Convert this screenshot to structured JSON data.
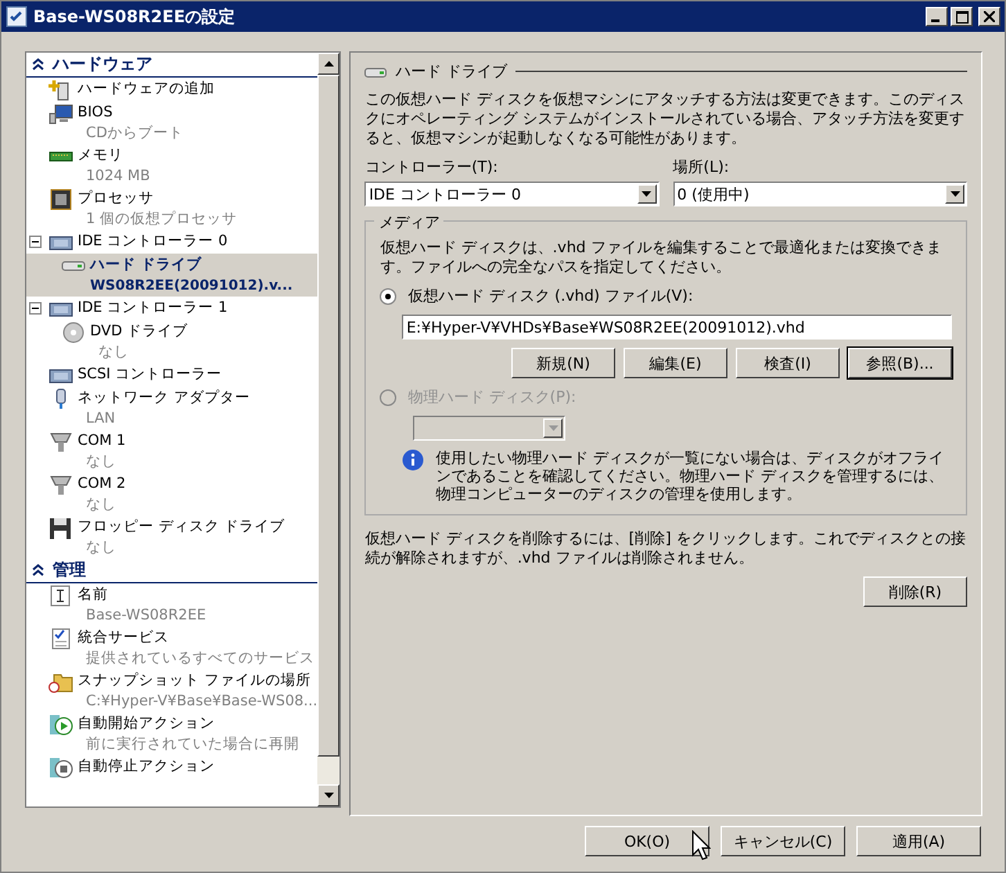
{
  "window": {
    "title": "Base-WS08R2EEの設定"
  },
  "sidebar": {
    "sections": [
      {
        "title": "ハードウェア",
        "items": [
          {
            "name": "ハードウェアの追加",
            "selected": false
          },
          {
            "name": "BIOS",
            "detail": "CDからブート",
            "selected": false
          },
          {
            "name": "メモリ",
            "detail": "1024 MB",
            "selected": false
          },
          {
            "name": "プロセッサ",
            "detail": "1 個の仮想プロセッサ",
            "selected": false
          },
          {
            "name": "IDE コントローラー 0",
            "expanded": true,
            "selected": false,
            "children": [
              {
                "name": "ハード ドライブ",
                "detail": "WS08R2EE(20091012).v...",
                "selected": true
              }
            ]
          },
          {
            "name": "IDE コントローラー 1",
            "expanded": true,
            "selected": false,
            "children": [
              {
                "name": "DVD ドライブ",
                "detail": "なし",
                "selected": false
              }
            ]
          },
          {
            "name": "SCSI コントローラー",
            "selected": false
          },
          {
            "name": "ネットワーク アダプター",
            "detail": "LAN",
            "selected": false
          },
          {
            "name": "COM 1",
            "detail": "なし",
            "selected": false
          },
          {
            "name": "COM 2",
            "detail": "なし",
            "selected": false
          },
          {
            "name": "フロッピー ディスク ドライブ",
            "detail": "なし",
            "selected": false
          }
        ]
      },
      {
        "title": "管理",
        "items": [
          {
            "name": "名前",
            "detail": "Base-WS08R2EE",
            "selected": false
          },
          {
            "name": "統合サービス",
            "detail": "提供されているすべてのサービス",
            "selected": false
          },
          {
            "name": "スナップショット ファイルの場所",
            "detail": "C:¥Hyper-V¥Base¥Base-WS08...",
            "selected": false
          },
          {
            "name": "自動開始アクション",
            "detail": "前に実行されていた場合に再開",
            "selected": false
          },
          {
            "name": "自動停止アクション",
            "selected": false
          }
        ]
      }
    ]
  },
  "panel": {
    "title": "ハード ドライブ",
    "intro": "この仮想ハード ディスクを仮想マシンにアタッチする方法は変更できます。このディスクにオペレーティング システムがインストールされている場合、アタッチ方法を変更すると、仮想マシンが起動しなくなる可能性があります。",
    "controller": {
      "label": "コントローラー(T):",
      "value": "IDE コントローラー 0"
    },
    "location": {
      "label": "場所(L):",
      "value": "0 (使用中)"
    },
    "media": {
      "title": "メディア",
      "description": "仮想ハード ディスクは、.vhd ファイルを編集することで最適化または変換できます。ファイルへの完全なパスを指定してください。",
      "options": [
        {
          "label": "仮想ハード ディスク (.vhd) ファイル(V):",
          "selected": true,
          "disabled": false
        },
        {
          "label": "物理ハード ディスク(P):",
          "selected": false,
          "disabled": true
        }
      ],
      "path": "E:¥Hyper-V¥VHDs¥Base¥WS08R2EE(20091012).vhd",
      "buttons": [
        {
          "label": "新規(N)",
          "focused": false
        },
        {
          "label": "編集(E)",
          "focused": false
        },
        {
          "label": "検査(I)",
          "focused": false
        },
        {
          "label": "参照(B)...",
          "focused": true
        }
      ],
      "info": "使用したい物理ハード ディスクが一覧にない場合は、ディスクがオフラインであることを確認してください。物理ハード ディスクを管理するには、物理コンピューターのディスクの管理を使用します。"
    },
    "remove_note": "仮想ハード ディスクを削除するには、[削除] をクリックします。これでディスクとの接続が解除されますが、.vhd ファイルは削除されません。",
    "remove_button": "削除(R)"
  },
  "buttons": [
    "OK(O)",
    "キャンセル(C)",
    "適用(A)"
  ]
}
